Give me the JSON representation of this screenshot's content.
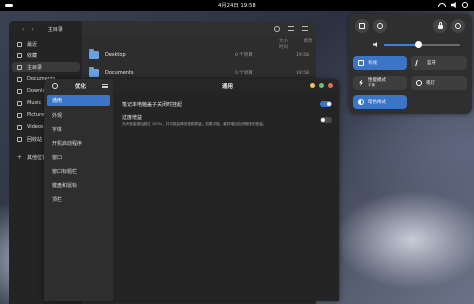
{
  "topbar": {
    "date": "4月24日  19:58"
  },
  "file_manager": {
    "path": "主目录",
    "columns": [
      "大小",
      "修改时间"
    ],
    "sidebar": [
      {
        "label": "最近"
      },
      {
        "label": "收藏"
      },
      {
        "label": "主目录"
      },
      {
        "label": "Documents"
      },
      {
        "label": "Downloads"
      },
      {
        "label": "Music"
      },
      {
        "label": "Pictures"
      },
      {
        "label": "Videos"
      },
      {
        "label": "回收站"
      },
      {
        "label": "其他位置"
      }
    ],
    "rows": [
      {
        "name": "Desktop",
        "size": "0 个项目",
        "modified": "19:58"
      },
      {
        "name": "Documents",
        "size": "0 个项目",
        "modified": "19:58"
      }
    ]
  },
  "tweaks": {
    "app_title": "优化",
    "page_title": "通用",
    "sidebar": [
      {
        "label": "通用"
      },
      {
        "label": "外观"
      },
      {
        "label": "字体"
      },
      {
        "label": "开机启动程序"
      },
      {
        "label": "窗口"
      },
      {
        "label": "窗口标题栏"
      },
      {
        "label": "键盘和鼠标"
      },
      {
        "label": "顶栏"
      }
    ],
    "settings": [
      {
        "title": "笔记本电脑盖子关闭时挂起",
        "subtitle": "",
        "enabled": true
      },
      {
        "title": "过度增益",
        "subtitle": "允许音量增加超过 100%，并可能会降低音频质量；如果可能，最好增加应用程序的音量。",
        "enabled": false
      }
    ],
    "accent_color": "#3b75c8"
  },
  "quick_settings": {
    "volume_level": 0.45,
    "tiles": [
      {
        "label": "有线",
        "subtitle": "",
        "icon": "wired-network-icon",
        "on": true
      },
      {
        "label": "蓝牙",
        "subtitle": "",
        "icon": "bluetooth-icon",
        "on": false
      },
      {
        "label": "性能模式",
        "subtitle": "平衡",
        "icon": "power-mode-icon",
        "on": false
      },
      {
        "label": "夜灯",
        "subtitle": "",
        "icon": "night-light-icon",
        "on": false
      },
      {
        "label": "暗色样式",
        "subtitle": "",
        "icon": "dark-style-icon",
        "on": true
      }
    ],
    "accent_color": "#3b75c8"
  }
}
